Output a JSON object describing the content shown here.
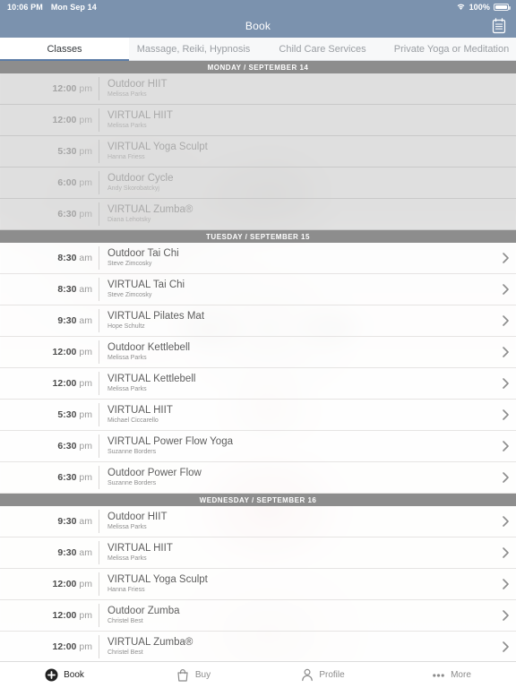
{
  "status_bar": {
    "time": "10:06 PM",
    "date": "Mon Sep 14",
    "battery_percent": "100%",
    "wifi_icon": "wifi-icon",
    "battery_icon": "battery-full-icon"
  },
  "nav": {
    "title": "Book",
    "action_icon": "calendar-icon"
  },
  "tabs": [
    {
      "label": "Classes",
      "active": true
    },
    {
      "label": "Massage, Reiki, Hypnosis",
      "active": false
    },
    {
      "label": "Child Care Services",
      "active": false
    },
    {
      "label": "Private Yoga or Meditation",
      "active": false
    }
  ],
  "schedule": [
    {
      "day_header": "MONDAY / SEPTEMBER 14",
      "past": true,
      "classes": [
        {
          "time": "12:00",
          "meridiem": "pm",
          "name": "Outdoor HIIT",
          "instructor": "Melissa Parks",
          "chevron": false
        },
        {
          "time": "12:00",
          "meridiem": "pm",
          "name": "VIRTUAL HIIT",
          "instructor": "Melissa Parks",
          "chevron": false
        },
        {
          "time": "5:30",
          "meridiem": "pm",
          "name": "VIRTUAL Yoga Sculpt",
          "instructor": "Hanna Friess",
          "chevron": false
        },
        {
          "time": "6:00",
          "meridiem": "pm",
          "name": "Outdoor Cycle",
          "instructor": "Andy Skorobatckyj",
          "chevron": false
        },
        {
          "time": "6:30",
          "meridiem": "pm",
          "name": "VIRTUAL Zumba®",
          "instructor": "Diana Lehotsky",
          "chevron": false
        }
      ]
    },
    {
      "day_header": "TUESDAY / SEPTEMBER 15",
      "past": false,
      "classes": [
        {
          "time": "8:30",
          "meridiem": "am",
          "name": "Outdoor Tai Chi",
          "instructor": "Steve Zimcosky",
          "chevron": true
        },
        {
          "time": "8:30",
          "meridiem": "am",
          "name": "VIRTUAL Tai Chi",
          "instructor": "Steve Zimcosky",
          "chevron": true
        },
        {
          "time": "9:30",
          "meridiem": "am",
          "name": "VIRTUAL Pilates Mat",
          "instructor": "Hope Schultz",
          "chevron": true
        },
        {
          "time": "12:00",
          "meridiem": "pm",
          "name": "Outdoor Kettlebell",
          "instructor": "Melissa Parks",
          "chevron": true
        },
        {
          "time": "12:00",
          "meridiem": "pm",
          "name": "VIRTUAL Kettlebell",
          "instructor": "Melissa Parks",
          "chevron": true
        },
        {
          "time": "5:30",
          "meridiem": "pm",
          "name": "VIRTUAL HIIT",
          "instructor": "Michael Ciccarello",
          "chevron": true
        },
        {
          "time": "6:30",
          "meridiem": "pm",
          "name": "VIRTUAL Power Flow Yoga",
          "instructor": "Suzanne Borders",
          "chevron": true
        },
        {
          "time": "6:30",
          "meridiem": "pm",
          "name": "Outdoor Power Flow",
          "instructor": "Suzanne Borders",
          "chevron": true
        }
      ]
    },
    {
      "day_header": "WEDNESDAY / SEPTEMBER 16",
      "past": false,
      "classes": [
        {
          "time": "9:30",
          "meridiem": "am",
          "name": "Outdoor HIIT",
          "instructor": "Melissa Parks",
          "chevron": true
        },
        {
          "time": "9:30",
          "meridiem": "am",
          "name": "VIRTUAL HIIT",
          "instructor": "Melissa Parks",
          "chevron": true
        },
        {
          "time": "12:00",
          "meridiem": "pm",
          "name": "VIRTUAL Yoga Sculpt",
          "instructor": "Hanna Friess",
          "chevron": true
        },
        {
          "time": "12:00",
          "meridiem": "pm",
          "name": "Outdoor Zumba",
          "instructor": "Christel Best",
          "chevron": true
        },
        {
          "time": "12:00",
          "meridiem": "pm",
          "name": "VIRTUAL Zumba®",
          "instructor": "Christel Best",
          "chevron": true
        }
      ]
    }
  ],
  "bottom_nav": [
    {
      "label": "Book",
      "icon": "plus-circle-icon",
      "active": true
    },
    {
      "label": "Buy",
      "icon": "shopping-bag-icon",
      "active": false
    },
    {
      "label": "Profile",
      "icon": "person-icon",
      "active": false
    },
    {
      "label": "More",
      "icon": "ellipsis-icon",
      "active": false
    }
  ],
  "colors": {
    "header_blue": "#7b92ae",
    "tab_accent": "#5b7ca6",
    "day_header_grey": "#8d8d8d"
  }
}
